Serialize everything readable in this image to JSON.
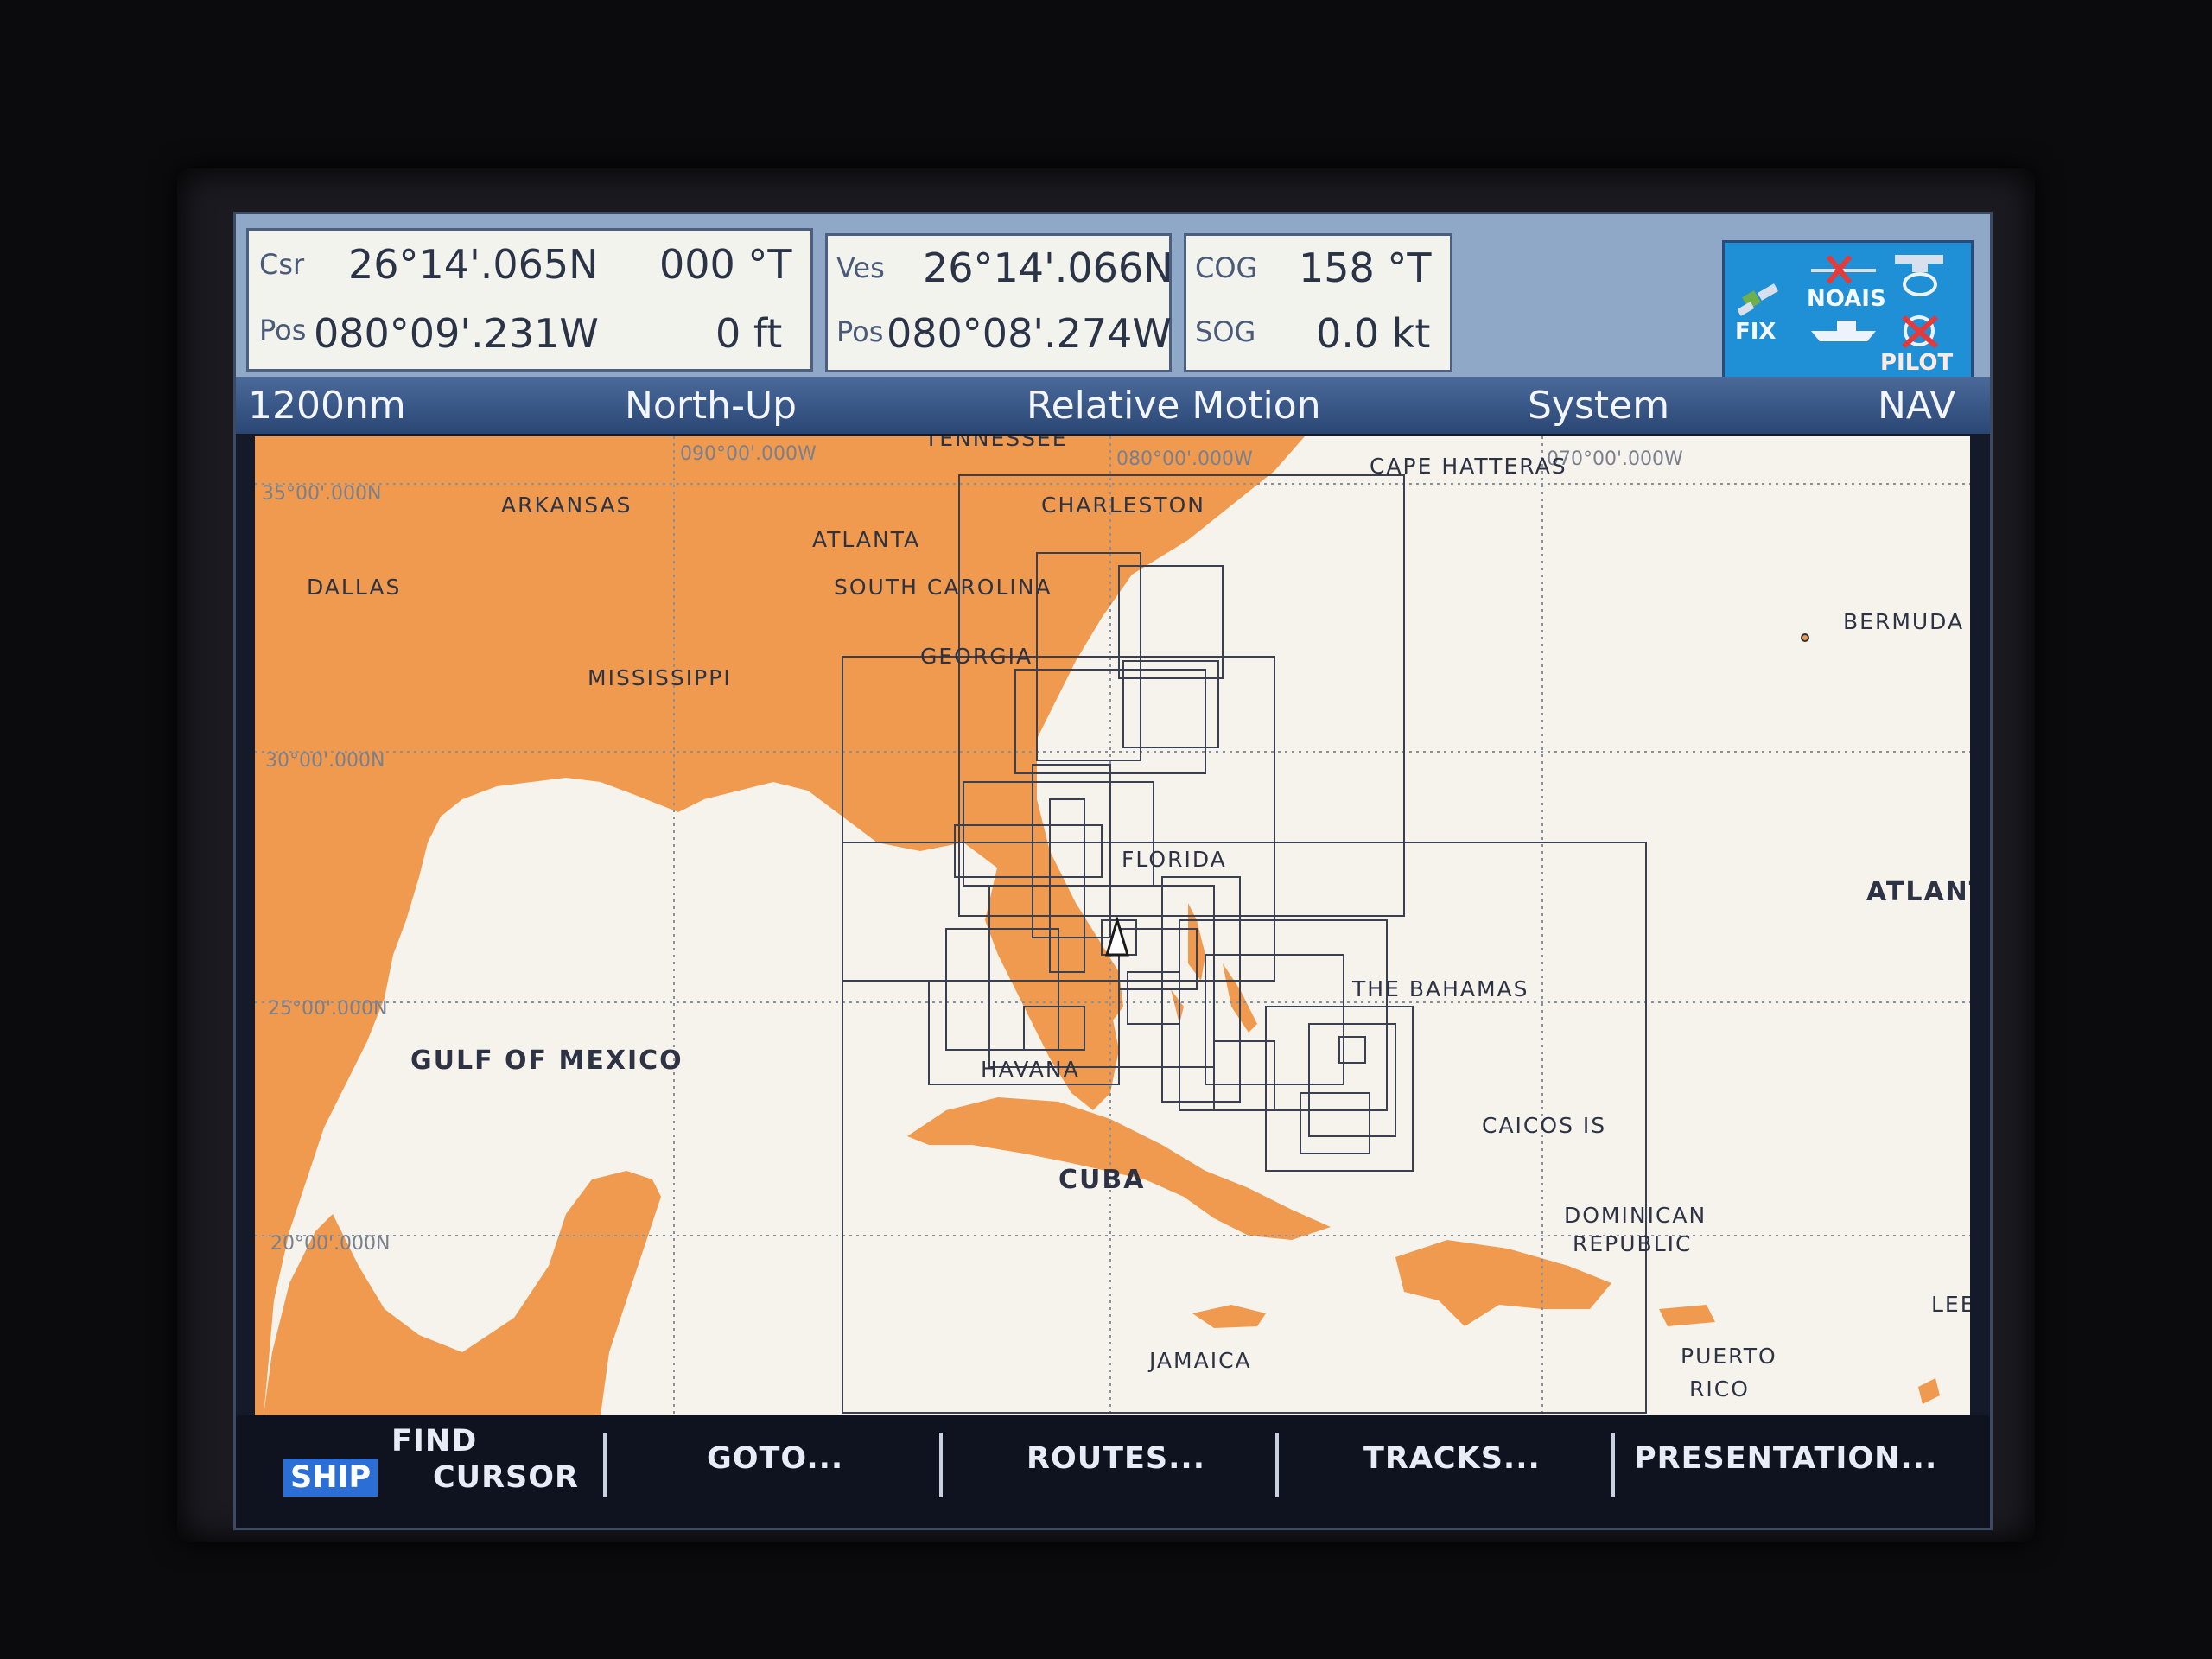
{
  "cursor": {
    "label_top": "Csr",
    "label_bottom": "Pos",
    "lat": "26°14'.065N",
    "lon": "080°09'.231W",
    "bearing": "000 °T",
    "depth": "0 ft"
  },
  "vessel": {
    "label_top": "Ves",
    "label_bottom": "Pos",
    "lat": "26°14'.066N",
    "lon": "080°08'.274W"
  },
  "motion": {
    "cog_label": "COG",
    "cog_value": "158 °T",
    "sog_label": "SOG",
    "sog_value": "0.0 kt"
  },
  "status": {
    "fix": "FIX",
    "noais": "NOAIS",
    "pilot": "PILOT"
  },
  "titlebar": {
    "range": "1200nm",
    "orientation": "North-Up",
    "motion_mode": "Relative Motion",
    "menu": "System",
    "mode": "NAV"
  },
  "chart": {
    "grid_labels": {
      "lon_090": "090°00'.000W",
      "lon_080": "080°00'.000W",
      "lon_070": "070°00'.000W",
      "lat_35": "35°00'.000N",
      "lat_30": "30°00'.000N",
      "lat_25": "25°00'.000N",
      "lat_20": "20°00'.000N"
    },
    "places": {
      "tennessee": "TENNESSEE",
      "cape_hatteras": "CAPE HATTERAS",
      "arkansas": "ARKANSAS",
      "charleston": "CHARLESTON",
      "atlanta": "ATLANTA",
      "dallas": "DALLAS",
      "south_carolina": "SOUTH CAROLINA",
      "bermuda": "BERMUDA",
      "georgia": "GEORGIA",
      "mississippi": "MISSISSIPPI",
      "florida": "FLORIDA",
      "atlantic": "ATLANT",
      "bahamas": "THE BAHAMAS",
      "gulf": "GULF OF MEXICO",
      "havana": "HAVANA",
      "caicos": "CAICOS IS",
      "cuba": "CUBA",
      "dominican": "DOMINICAN",
      "republic": "REPUBLIC",
      "lee": "LEE",
      "jamaica": "JAMAICA",
      "puerto": "PUERTO",
      "rico": "RICO"
    },
    "colors": {
      "land": "#ef9a4e",
      "sea": "#f6f3ec",
      "grid": "#8a8f9c",
      "chart_box": "#3a4050"
    }
  },
  "softkeys": {
    "ship": "SHIP",
    "find": "FIND",
    "cursor": "CURSOR",
    "goto": "GOTO...",
    "routes": "ROUTES...",
    "tracks": "TRACKS...",
    "presentation": "PRESENTATION..."
  }
}
